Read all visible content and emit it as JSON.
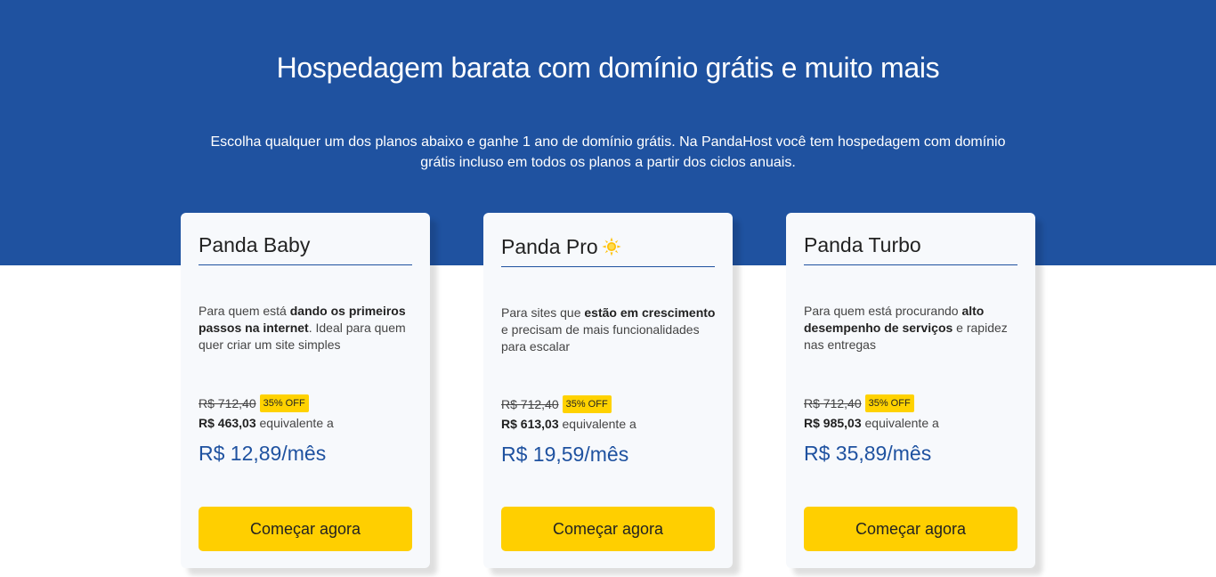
{
  "hero": {
    "title": "Hospedagem barata com domínio grátis e muito mais",
    "subtitle_line1": "Escolha qualquer um dos planos abaixo e ganhe 1 ano de domínio grátis. Na PandaHost você tem hospedagem com domínio",
    "subtitle_line2": "grátis incluso em todos os planos a partir dos ciclos anuais.",
    "background": "#1f52a0"
  },
  "accent_color": "#ffcf00",
  "price_color": "#1f52a0",
  "plans": [
    {
      "name": "Panda Baby",
      "icon": null,
      "desc_pre": "Para quem está ",
      "desc_bold": "dando os primeiros passos na internet",
      "desc_post": ". Ideal para quem quer criar um site simples",
      "old_price": "R$ 712,40",
      "badge": "35% OFF",
      "year_price": "R$ 463,03",
      "year_suffix": " equivalente a",
      "month_price": "R$ 12,89/mês",
      "cta": "Começar agora"
    },
    {
      "name": "Panda Pro",
      "icon": "sun-icon",
      "desc_pre": "Para sites que ",
      "desc_bold": "estão em crescimento",
      "desc_post": " e precisam de mais funcionalidades para escalar",
      "old_price": "R$ 712,40",
      "badge": "35% OFF",
      "year_price": "R$ 613,03",
      "year_suffix": " equivalente a",
      "month_price": "R$ 19,59/mês",
      "cta": "Começar agora"
    },
    {
      "name": "Panda Turbo",
      "icon": null,
      "desc_pre": "Para quem está procurando ",
      "desc_bold": "alto desempenho de serviços",
      "desc_post": " e rapidez nas entregas",
      "old_price": "R$ 712,40",
      "badge": "35% OFF",
      "year_price": "R$ 985,03",
      "year_suffix": " equivalente a",
      "month_price": "R$ 35,89/mês",
      "cta": "Começar agora"
    }
  ]
}
